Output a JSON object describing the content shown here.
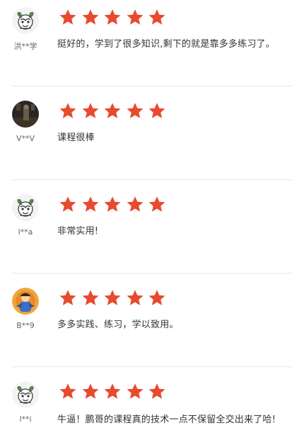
{
  "colors": {
    "star": "#e84a2f",
    "divider": "#e6e6e6"
  },
  "reviews": [
    {
      "avatar_icon": "tiger-avatar-icon",
      "username": "洪**学",
      "rating": 5,
      "comment": "挺好的，学到了很多知识,剩下的就是靠多多练习了。"
    },
    {
      "avatar_icon": "photo-avatar-icon",
      "username": "V**V",
      "rating": 5,
      "comment": "课程很棒"
    },
    {
      "avatar_icon": "tiger-avatar-icon",
      "username": "l**a",
      "rating": 5,
      "comment": "非常实用!"
    },
    {
      "avatar_icon": "cartoon-avatar-icon",
      "username": "B**9",
      "rating": 5,
      "comment": "多多实践、练习，学以致用。"
    },
    {
      "avatar_icon": "tiger-avatar-icon",
      "username": "l**i",
      "rating": 5,
      "comment": "牛逼！鹏哥的课程真的技术一点不保留全交出来了哈!"
    }
  ]
}
